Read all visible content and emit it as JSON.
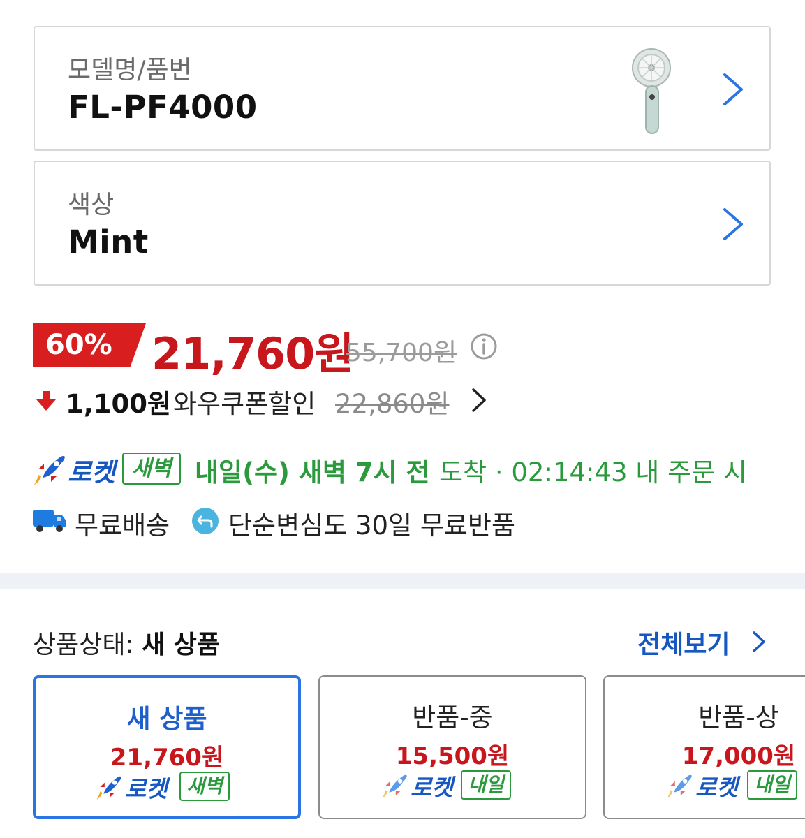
{
  "model_option": {
    "label": "모델명/품번",
    "value": "FL-PF4000"
  },
  "color_option": {
    "label": "색상",
    "value": "Mint"
  },
  "price": {
    "discount": "60%",
    "sale": "21,760원",
    "original": "55,700원"
  },
  "coupon": {
    "amount": "1,100원",
    "text": "와우쿠폰할인",
    "price": "22,860원"
  },
  "delivery": {
    "rocket_label": "로켓",
    "rocket_tag": "새벽",
    "eta_bold": "내일(수) 새벽 7시 전",
    "eta_rest": "도착 · 02:14:43 내 주문 시"
  },
  "benefits": {
    "free_shipping": "무료배송",
    "free_return": "단순변심도 30일 무료반품"
  },
  "condition": {
    "title_prefix": "상품상태:",
    "title_value": "새 상품",
    "view_all": "전체보기",
    "cards": [
      {
        "name": "새 상품",
        "price": "21,760원",
        "rocket": "로켓",
        "tag": "새벽",
        "selected": true
      },
      {
        "name": "반품-중",
        "price": "15,500원",
        "rocket": "로켓",
        "tag": "내일",
        "selected": false
      },
      {
        "name": "반품-상",
        "price": "17,000원",
        "rocket": "로켓",
        "tag": "내일",
        "selected": false
      }
    ]
  },
  "colors": {
    "accent_red": "#c8161d",
    "rocket_blue": "#1657c2",
    "delivery_green": "#2b9a3d",
    "selected_border": "#2b74e4"
  }
}
